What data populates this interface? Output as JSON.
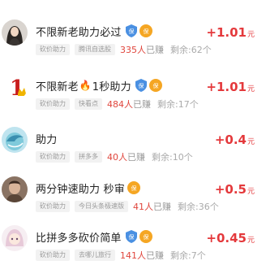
{
  "tasks": [
    {
      "title": "不限新老助力必过",
      "has_fire": false,
      "title_suffix": "",
      "tags": [
        "砍价助力",
        "腾讯自选股"
      ],
      "earned": "335人",
      "earned_suffix": "已赚",
      "remaining": "剩余:62个",
      "reward": "+1.01",
      "unit": "元",
      "avatar_icon": "woman-portrait-icon"
    },
    {
      "title": "不限新老",
      "has_fire": true,
      "title_suffix": "1秒助力",
      "tags": [
        "砍价助力",
        "快看点"
      ],
      "earned": "484人",
      "earned_suffix": "已赚",
      "remaining": "剩余:17个",
      "reward": "+1.01",
      "unit": "元",
      "avatar_icon": "number-one-icon"
    },
    {
      "title": "助力",
      "has_fire": false,
      "title_suffix": "",
      "tags": [
        "砍价助力",
        "拼多多"
      ],
      "earned": "40人",
      "earned_suffix": "已赚",
      "remaining": "剩余:10个",
      "reward": "+0.4",
      "unit": "元",
      "avatar_icon": "dolphin-icon"
    },
    {
      "title": "两分钟速助力 秒审",
      "has_fire": false,
      "title_suffix": "",
      "tags": [
        "砍价助力",
        "今日头条极速版"
      ],
      "earned": "41人",
      "earned_suffix": "已赚",
      "remaining": "剩余:36个",
      "reward": "+0.5",
      "unit": "元",
      "avatar_icon": "man-portrait-icon"
    },
    {
      "title": "比拼多多砍价简单",
      "has_fire": false,
      "title_suffix": "",
      "tags": [
        "砍价助力",
        "去哪儿旅行"
      ],
      "earned": "141人",
      "earned_suffix": "已赚",
      "remaining": "剩余:7个",
      "reward": "+0.45",
      "unit": "元",
      "avatar_icon": "anime-girl-icon"
    }
  ],
  "badges": {
    "shield_label": "保",
    "vip_label": "保"
  },
  "colors": {
    "accent_red": "#e4393c",
    "shield_blue": "#4a90e2",
    "vip_orange": "#f5a623"
  }
}
